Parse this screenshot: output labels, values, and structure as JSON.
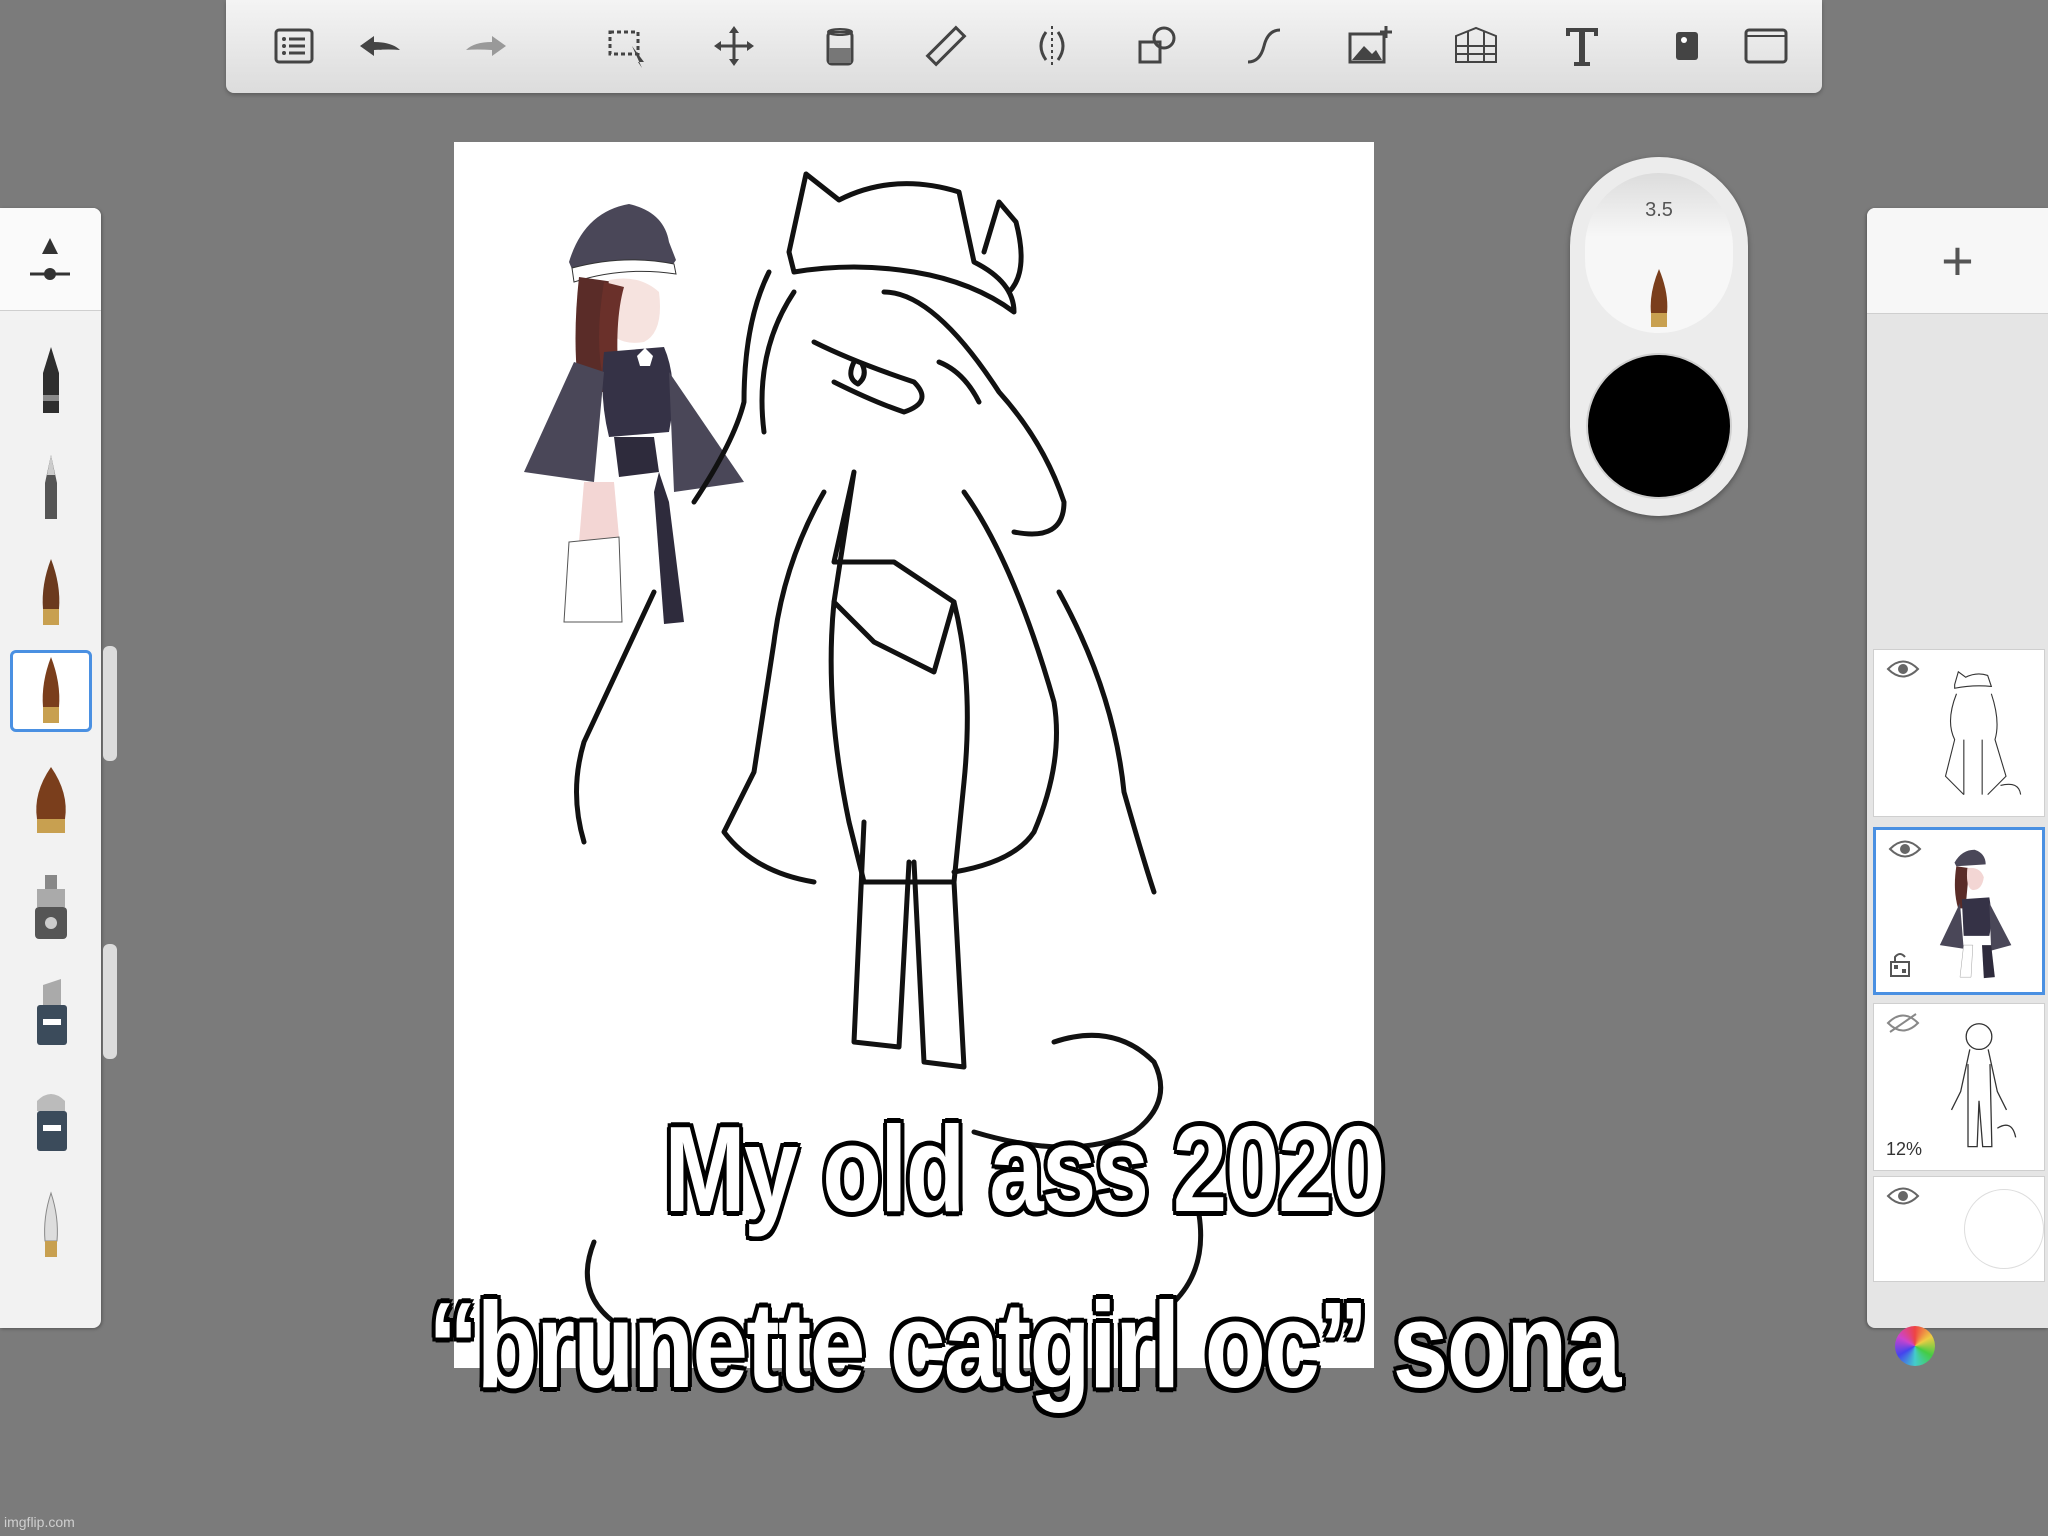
{
  "toolbar": {
    "tools": [
      "list-icon",
      "undo-icon",
      "redo-icon",
      "selection-icon",
      "transform-icon",
      "fill-icon",
      "ruler-icon",
      "symmetry-icon",
      "shapes-icon",
      "stroke-icon",
      "import-image-icon",
      "perspective-icon",
      "text-icon",
      "flipbook-icon",
      "canvas-icon"
    ]
  },
  "brush_puck": {
    "size": "3.5",
    "color": "#000000"
  },
  "layers": [
    {
      "name": "layer-lineart",
      "visible": true
    },
    {
      "name": "layer-colored-sketch",
      "visible": true,
      "locked": true
    },
    {
      "name": "layer-base-figure",
      "visible": false,
      "opacity": "12%"
    },
    {
      "name": "layer-background",
      "visible": true
    }
  ],
  "caption": {
    "line1": "My old ass 2020",
    "line2": "“brunette catgirl oc” sona"
  },
  "watermark": "imgflip.com",
  "colors": {
    "accent": "#4a90e2",
    "background": "#7b7b7b"
  }
}
